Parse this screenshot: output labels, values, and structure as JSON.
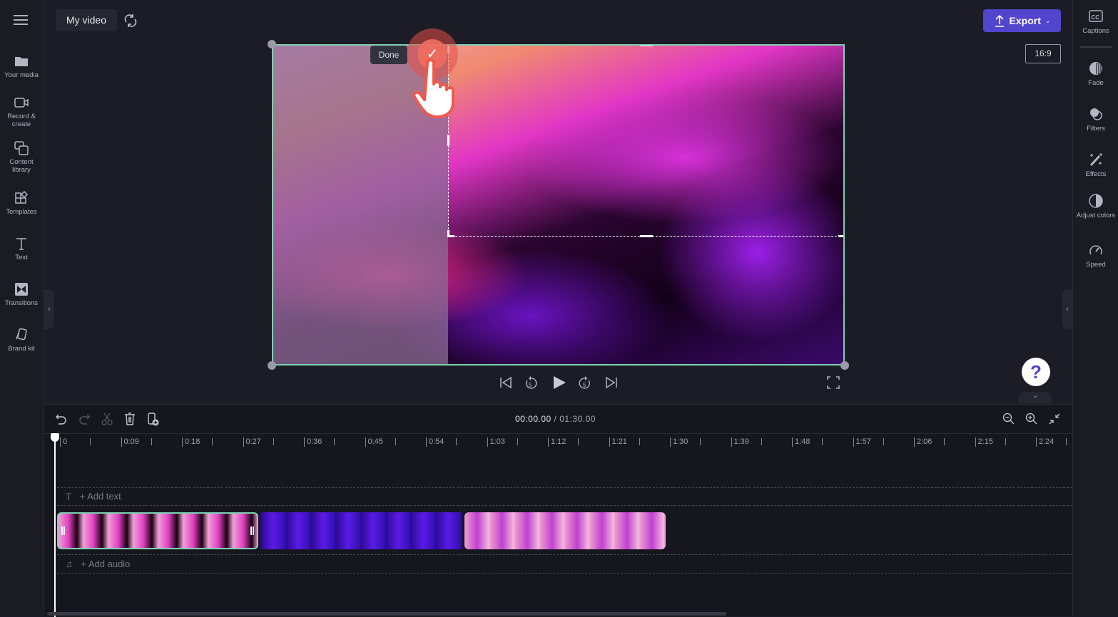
{
  "header": {
    "project_title": "My video",
    "export_label": "Export",
    "aspect_ratio": "16:9"
  },
  "left_sidebar": {
    "items": [
      {
        "label": "Your media",
        "icon": "folder-icon"
      },
      {
        "label": "Record & create",
        "icon": "video-camera-icon"
      },
      {
        "label": "Content library",
        "icon": "content-library-icon"
      },
      {
        "label": "Templates",
        "icon": "templates-icon"
      },
      {
        "label": "Text",
        "icon": "text-icon"
      },
      {
        "label": "Transitions",
        "icon": "transitions-icon"
      },
      {
        "label": "Brand kit",
        "icon": "brand-kit-icon"
      }
    ]
  },
  "right_sidebar": {
    "items": [
      {
        "label": "Captions",
        "icon": "captions-icon"
      },
      {
        "label": "Fade",
        "icon": "fade-icon"
      },
      {
        "label": "Filters",
        "icon": "filters-icon"
      },
      {
        "label": "Effects",
        "icon": "effects-icon"
      },
      {
        "label": "Adjust colors",
        "icon": "adjust-colors-icon"
      },
      {
        "label": "Speed",
        "icon": "speed-icon"
      }
    ]
  },
  "preview": {
    "done_label": "Done"
  },
  "timeline": {
    "current_time": "00:00.00",
    "separator": " / ",
    "total_time": "01:30.00",
    "ruler": [
      "0",
      "0:09",
      "0:18",
      "0:27",
      "0:36",
      "0:45",
      "0:54",
      "1:03",
      "1:12",
      "1:21",
      "1:30",
      "1:39",
      "1:48",
      "1:57",
      "2:06",
      "2:15",
      "2:24"
    ],
    "add_text": "+ Add text",
    "add_audio": "+ Add audio"
  },
  "help_label": "?",
  "colors": {
    "accent": "#5145cd",
    "selection": "#7ed0b0",
    "background": "#1c1c26"
  }
}
